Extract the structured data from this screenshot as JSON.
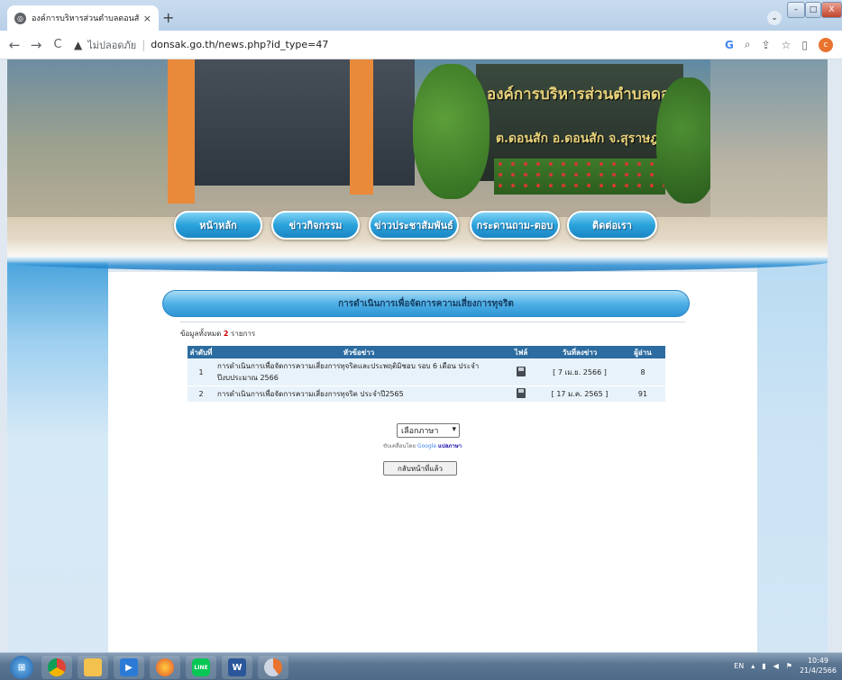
{
  "browser": {
    "tab_title": "องค์การบริหารส่วนตำบลดอนสัก อำเภ",
    "tab_close": "×",
    "new_tab": "+",
    "security_label": "ไม่ปลอดภัย",
    "url": "donsak.go.th/news.php?id_type=47",
    "back_glyph": "←",
    "forward_glyph": "→",
    "reload_glyph": "C",
    "warn_glyph": "▲",
    "profile_letter": "c",
    "window_min": "–",
    "window_max": "□",
    "window_close": "X",
    "caret_glyph": "⌄"
  },
  "banner": {
    "sign_line1": "องค์การบริหารส่วนตำบลดอนสัก",
    "sign_line2": "ต.ดอนสัก อ.ดอนสัก จ.สุราษฎร์ธานี"
  },
  "nav": {
    "items": [
      {
        "label": "หน้าหลัก"
      },
      {
        "label": "ข่าวกิจกรรม"
      },
      {
        "label": "ข่าวประชาสัมพันธ์"
      },
      {
        "label": "กระดานถาม-ตอบ"
      },
      {
        "label": "ติดต่อเรา"
      }
    ]
  },
  "section": {
    "title": "การดำเนินการเพื่อจัดการความเสี่ยงการทุจริต",
    "total_prefix": "ข้อมูลทั้งหมด",
    "total_count": "2",
    "total_suffix": "รายการ"
  },
  "table": {
    "headers": {
      "num": "ลำดับที่",
      "title": "หัวข้อข่าว",
      "file": "ไฟล์",
      "date": "วันที่ลงข่าว",
      "reads": "ผู้อ่าน"
    },
    "rows": [
      {
        "num": "1",
        "title": "การดำเนินการเพื่อจัดการความเสี่ยงการทุจริตและประพฤติมิชอบ รอบ 6 เดือน ประจำปีงบประมาณ 2566",
        "date": "[ 7 เม.ย. 2566 ]",
        "reads": "8"
      },
      {
        "num": "2",
        "title": "การดำเนินการเพื่อจัดการความเสี่ยงการทุจริต ประจำปี2565",
        "date": "[ 17 ม.ค. 2565 ]",
        "reads": "91"
      }
    ]
  },
  "translate": {
    "select_value": "เลือกภาษา",
    "select_arrow": "▾",
    "powered_prefix": "ขับเคลื่อนโดย",
    "google": "Google",
    "translate_label": "แปลภาษา"
  },
  "back_button": "กลับหน้าที่แล้ว",
  "taskbar": {
    "lang": "EN",
    "time": "10:49",
    "date": "21/4/2566"
  }
}
